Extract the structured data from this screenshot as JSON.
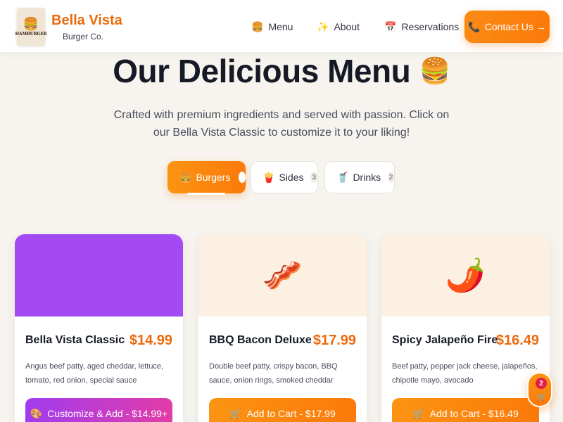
{
  "header": {
    "logo_text": "HAMBURGER",
    "brand_name": "Bella Vista",
    "brand_sub": "Burger Co.",
    "nav": [
      {
        "label": "Menu",
        "icon": "burger-icon"
      },
      {
        "label": "About",
        "icon": "sparkles-icon"
      },
      {
        "label": "Reservations",
        "icon": "calendar-icon"
      }
    ],
    "contact_label": "Contact Us →"
  },
  "hero": {
    "title": "Our Delicious Menu",
    "description": "Crafted with premium ingredients and served with passion. Click on our Bella Vista Classic to customize it to your liking!"
  },
  "tabs": [
    {
      "label": "Burgers",
      "icon": "burger-icon",
      "active": true
    },
    {
      "label": "Sides",
      "icon": "fries-icon",
      "count": "3"
    },
    {
      "label": "Drinks",
      "icon": "drink-icon",
      "count": "2"
    }
  ],
  "cards": [
    {
      "name": "Bella Vista Classic",
      "price": "$14.99",
      "description": "Angus beef patty, aged cheddar, lettuce, tomato, red onion, special sauce",
      "button": "Customize & Add - $14.99+",
      "image_color": "#a34af2"
    },
    {
      "name": "BBQ Bacon Deluxe",
      "price": "$17.99",
      "description": "Double beef patty, crispy bacon, BBQ sauce, onion rings, smoked cheddar",
      "button": "Add to Cart - $17.99",
      "image_icon": "bacon-icon"
    },
    {
      "name": "Spicy Jalapeño Fire",
      "price": "$16.49",
      "description": "Beef patty, pepper jack cheese, jalapeños, chipotle mayo, avocado",
      "button": "Add to Cart - $16.49",
      "image_icon": "chili-pepper-icon"
    }
  ],
  "cart": {
    "count": "2"
  },
  "colors": {
    "accent": "#fb7a0a",
    "price": "#ec6a0c",
    "purple": "#a34af2"
  }
}
